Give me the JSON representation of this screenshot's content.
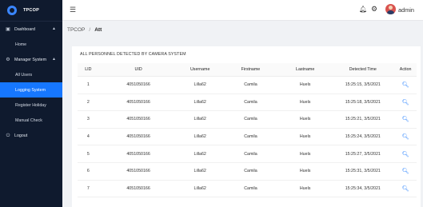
{
  "brand": {
    "name": "TPCOP"
  },
  "sidebar": {
    "dashboard": {
      "label": "Dashboard",
      "items": [
        {
          "label": "Home"
        }
      ]
    },
    "manager": {
      "label": "Manager System",
      "items": [
        {
          "label": "All Users"
        },
        {
          "label": "Logging System"
        },
        {
          "label": "Register Holiday"
        },
        {
          "label": "Manual Check"
        }
      ]
    },
    "logout": {
      "label": "Logout"
    }
  },
  "header": {
    "user": "admin"
  },
  "breadcrumb": {
    "root": "TPCOP",
    "current": "Att"
  },
  "card": {
    "title": "ALL PERSONNEL DETECTED BY CAMERA SYSTEM"
  },
  "table": {
    "headers": {
      "lid": "LID",
      "uid": "UID",
      "username": "Username",
      "firstname": "Firstname",
      "lastname": "Lastname",
      "time": "Detected Time",
      "action": "Action"
    },
    "rows": [
      {
        "lid": "1",
        "uid": "4051050166",
        "username": "Lilla62",
        "firstname": "Camila",
        "lastname": "Huels",
        "time": "15:25:15, 3/5/2021"
      },
      {
        "lid": "2",
        "uid": "4051050166",
        "username": "Lilla62",
        "firstname": "Camila",
        "lastname": "Huels",
        "time": "15:25:18, 3/5/2021"
      },
      {
        "lid": "3",
        "uid": "4051050166",
        "username": "Lilla62",
        "firstname": "Camila",
        "lastname": "Huels",
        "time": "15:25:21, 3/5/2021"
      },
      {
        "lid": "4",
        "uid": "4051050166",
        "username": "Lilla62",
        "firstname": "Camila",
        "lastname": "Huels",
        "time": "15:25:24, 3/5/2021"
      },
      {
        "lid": "5",
        "uid": "4051050166",
        "username": "Lilla62",
        "firstname": "Camila",
        "lastname": "Huels",
        "time": "15:25:27, 3/5/2021"
      },
      {
        "lid": "6",
        "uid": "4051050166",
        "username": "Lilla62",
        "firstname": "Camila",
        "lastname": "Huels",
        "time": "15:25:31, 3/5/2021"
      },
      {
        "lid": "7",
        "uid": "4051050166",
        "username": "Lilla62",
        "firstname": "Camila",
        "lastname": "Huels",
        "time": "15:25:34, 3/5/2021"
      }
    ]
  }
}
